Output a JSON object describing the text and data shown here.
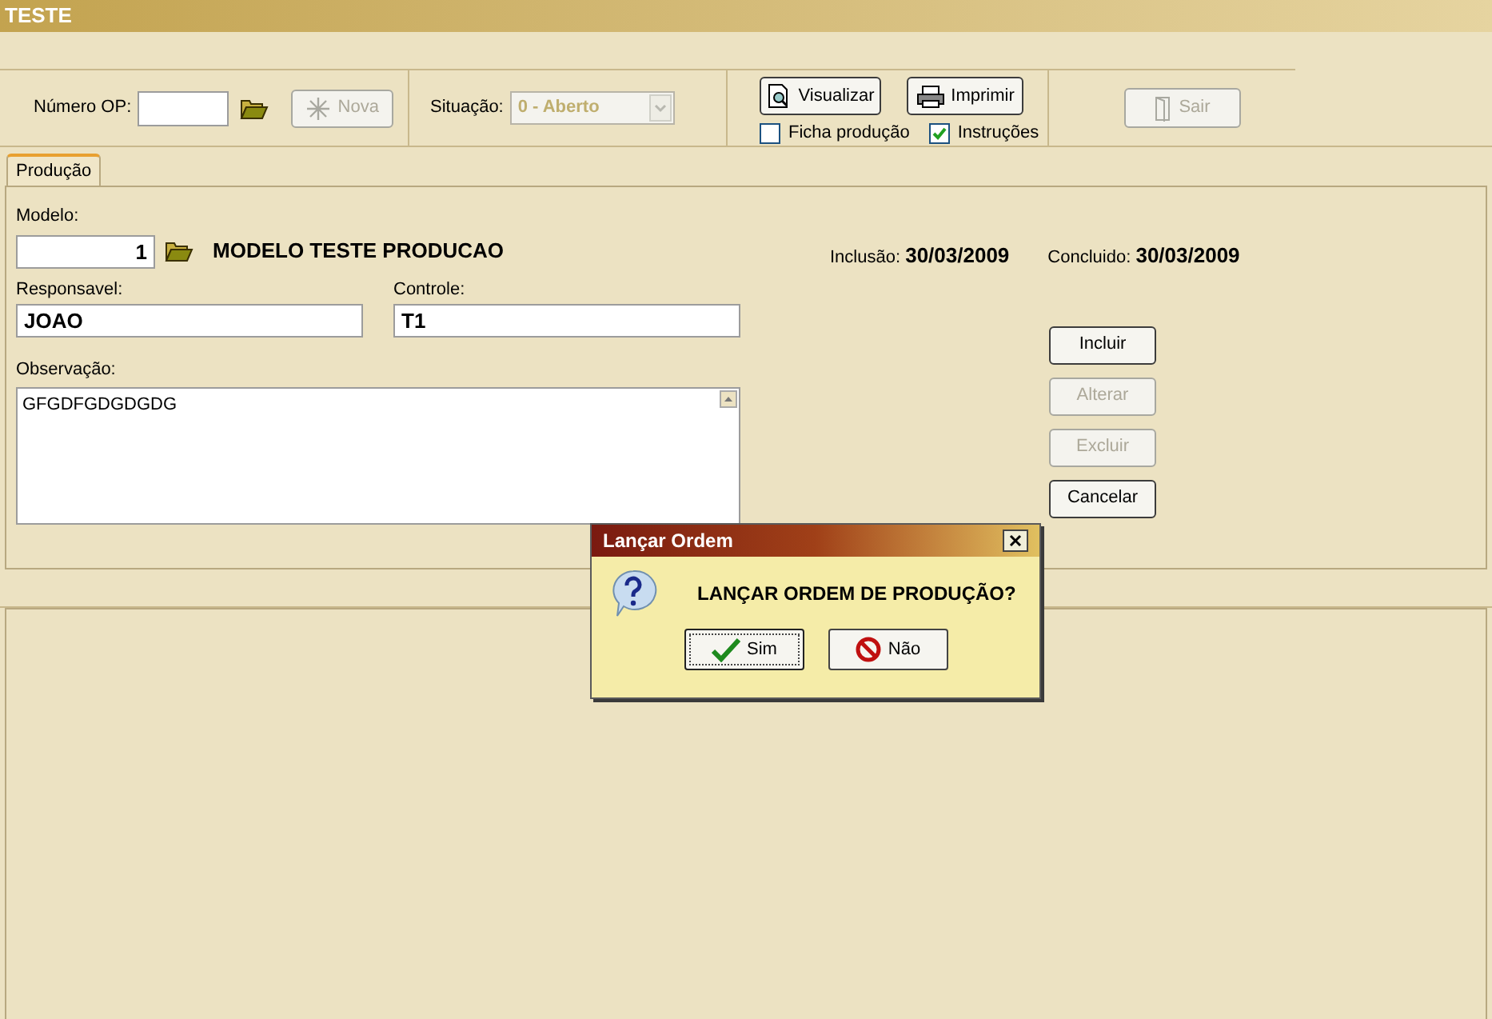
{
  "window": {
    "title": "TESTE"
  },
  "toolbar": {
    "numero_op": {
      "label": "Número OP:"
    },
    "nova_button": {
      "label": "Nova",
      "disabled": true
    },
    "situacao": {
      "label": "Situação:",
      "value": "0 - Aberto",
      "disabled": true
    },
    "visualizar_button": {
      "label": "Visualizar",
      "disabled": false
    },
    "imprimir_button": {
      "label": "Imprimir",
      "disabled": false
    },
    "checkboxes": [
      {
        "label": "Ficha produção",
        "checked": false
      },
      {
        "label": "Instruções",
        "checked": true
      }
    ],
    "sair_button": {
      "label": "Sair",
      "disabled": true
    }
  },
  "tabs": [
    {
      "label": "Produção",
      "selected": true
    }
  ],
  "form": {
    "modelo": {
      "label": "Modelo:",
      "value": "1",
      "description": "MODELO TESTE PRODUCAO"
    },
    "inclusao": {
      "label": "Inclusão:",
      "value": "30/03/2009"
    },
    "concluido": {
      "label": "Concluido:",
      "value": "30/03/2009"
    },
    "responsavel": {
      "label": "Responsavel:",
      "value": "JOAO"
    },
    "controle": {
      "label": "Controle:",
      "value": "T1"
    },
    "observacao": {
      "label": "Observação:",
      "value": "GFGDFGDGDGDG"
    },
    "buttons": [
      {
        "label": "Incluir",
        "disabled": false
      },
      {
        "label": "Alterar",
        "disabled": true
      },
      {
        "label": "Excluir",
        "disabled": true
      },
      {
        "label": "Cancelar",
        "disabled": false
      }
    ]
  },
  "dialog": {
    "title": "Lançar Ordem",
    "message": "LANÇAR ORDEM DE PRODUÇÃO?",
    "buttons": [
      {
        "label": "Sim",
        "kind": "confirm",
        "selected": true
      },
      {
        "label": "Não",
        "kind": "cancel",
        "selected": false
      }
    ]
  }
}
